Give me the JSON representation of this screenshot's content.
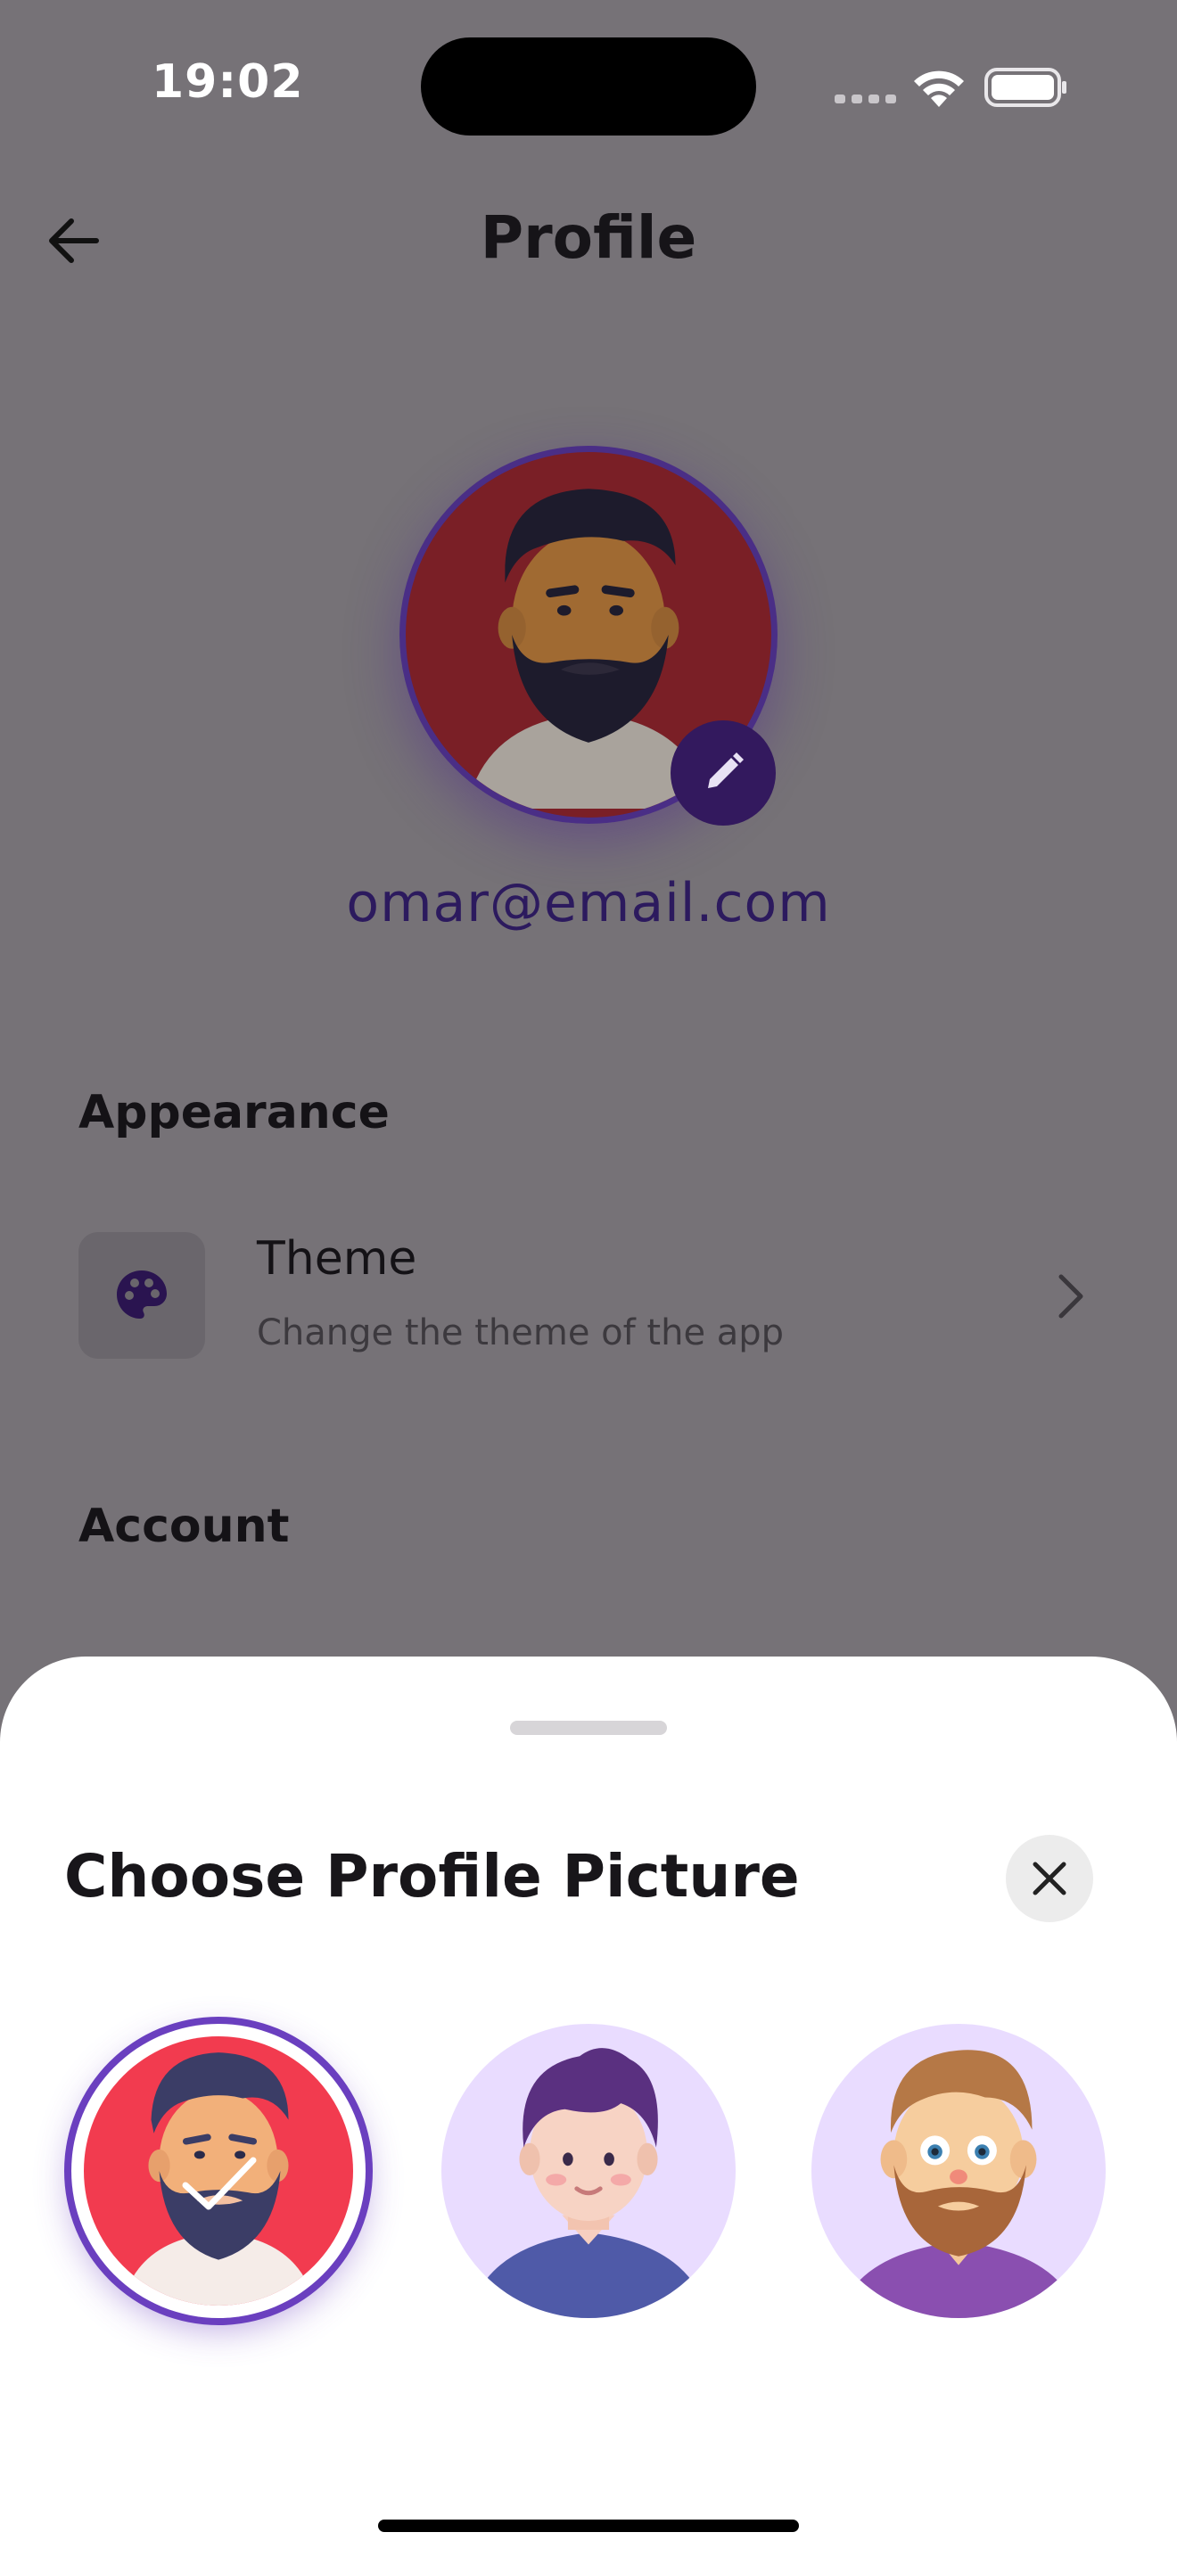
{
  "status_bar": {
    "time": "19:02"
  },
  "header": {
    "title": "Profile",
    "back_icon": "arrow-left-icon"
  },
  "profile": {
    "email": "omar@email.com",
    "edit_icon": "pencil-icon",
    "avatar": "bearded-man-avatar"
  },
  "sections": {
    "appearance": {
      "title": "Appearance",
      "theme_row": {
        "icon": "palette-icon",
        "title": "Theme",
        "subtitle": "Change the theme of the app"
      }
    },
    "account": {
      "title": "Account"
    }
  },
  "sheet": {
    "title": "Choose Profile Picture",
    "close_icon": "close-icon",
    "options": [
      {
        "name": "bearded-man-avatar",
        "selected": true
      },
      {
        "name": "purple-hair-man-avatar",
        "selected": false
      },
      {
        "name": "ginger-beard-man-avatar",
        "selected": false
      }
    ]
  },
  "colors": {
    "accent": "#6a3fbf",
    "fab": "#33195e",
    "scrim": "#767277"
  }
}
